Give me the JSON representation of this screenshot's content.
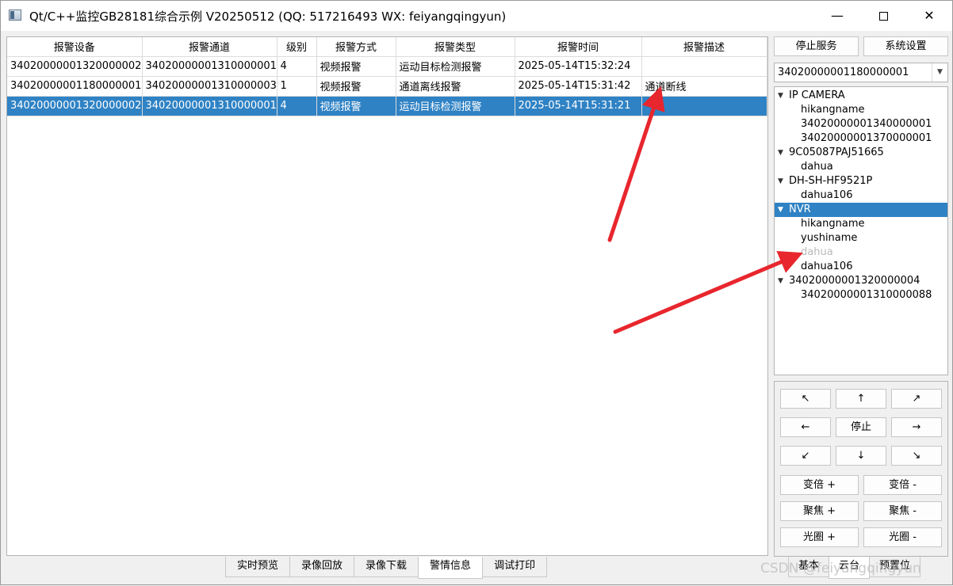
{
  "window": {
    "title": "Qt/C++监控GB28181综合示例 V20250512 (QQ: 517216493 WX: feiyangqingyun)",
    "minimize": "—",
    "close": "✕"
  },
  "table": {
    "headers": [
      "报警设备",
      "报警通道",
      "级别",
      "报警方式",
      "报警类型",
      "报警时间",
      "报警描述"
    ],
    "rows": [
      [
        "34020000001320000002",
        "34020000001310000001",
        "4",
        "视频报警",
        "运动目标检测报警",
        "2025-05-14T15:32:24",
        ""
      ],
      [
        "34020000001180000001",
        "34020000001310000003",
        "1",
        "视频报警",
        "通道离线报警",
        "2025-05-14T15:31:42",
        "通道断线"
      ],
      [
        "34020000001320000002",
        "34020000001310000001",
        "4",
        "视频报警",
        "运动目标检测报警",
        "2025-05-14T15:31:21",
        ""
      ]
    ],
    "selected_row": 2
  },
  "bottom_tabs": [
    "实时预览",
    "录像回放",
    "录像下载",
    "警情信息",
    "调试打印"
  ],
  "active_bottom_tab": "警情信息",
  "right_panel": {
    "stop_service": "停止服务",
    "settings": "系统设置",
    "device_select": "34020000001180000001",
    "tree": [
      {
        "label": "IP CAMERA",
        "children": [
          "hikangname",
          "34020000001340000001",
          "34020000001370000001"
        ]
      },
      {
        "label": "9C05087PAJ51665",
        "children": [
          "dahua"
        ]
      },
      {
        "label": "DH-SH-HF9521P",
        "children": [
          "dahua106"
        ]
      },
      {
        "label": "NVR",
        "children": [
          "hikangname",
          "yushiname",
          "dahua",
          "dahua106"
        ],
        "selected": true
      },
      {
        "label": "34020000001320000004",
        "children": [
          "34020000001310000088"
        ]
      }
    ],
    "ptz": {
      "up_left": "↖",
      "up": "↑",
      "up_right": "↗",
      "left": "←",
      "stop": "停止",
      "right": "→",
      "down_left": "↙",
      "down": "↓",
      "down_right": "↘",
      "zoom_in": "变倍 +",
      "zoom_out": "变倍 -",
      "focus_in": "聚焦 +",
      "focus_out": "聚焦 -",
      "iris_in": "光圈 +",
      "iris_out": "光圈 -"
    },
    "tabs": [
      "基本",
      "云台",
      "预置位"
    ],
    "active_tab": "云台"
  },
  "watermark": "CSDN @feiyangqingyun",
  "colors": {
    "selection": "#2f82c4",
    "arrow": "#e8262d"
  }
}
